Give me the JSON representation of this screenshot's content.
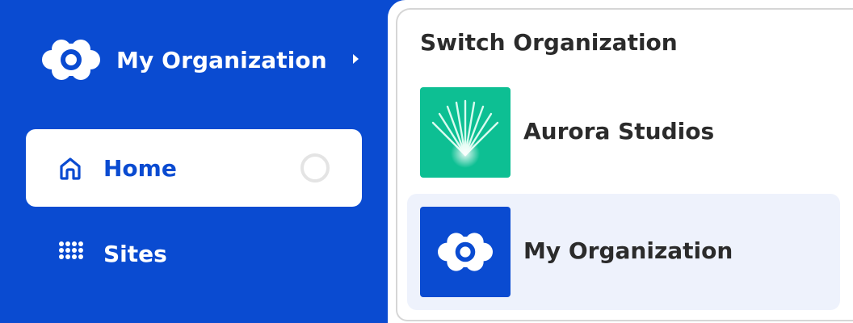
{
  "sidebar": {
    "org_header": {
      "name": "My Organization",
      "logo_icon": "org-flower-logo-icon",
      "chevron_icon": "chevron-right-icon"
    },
    "nav_items": [
      {
        "label": "Home",
        "icon": "home-icon",
        "active": true,
        "loading": true
      },
      {
        "label": "Sites",
        "icon": "grid-dots-icon",
        "active": false,
        "loading": false
      }
    ]
  },
  "switch_panel": {
    "title": "Switch Organization",
    "options": [
      {
        "label": "Aurora Studios",
        "logo_icon": "aurora-fan-logo-icon",
        "logo_color": "#0dbf93",
        "selected": false
      },
      {
        "label": "My Organization",
        "logo_icon": "org-flower-logo-icon",
        "logo_color": "#0a4bd1",
        "selected": true
      }
    ]
  },
  "colors": {
    "brand_blue": "#0a4bd1",
    "aurora_green": "#0dbf93",
    "selected_row_bg": "#eef2fc",
    "text_dark": "#2b2b2b"
  }
}
